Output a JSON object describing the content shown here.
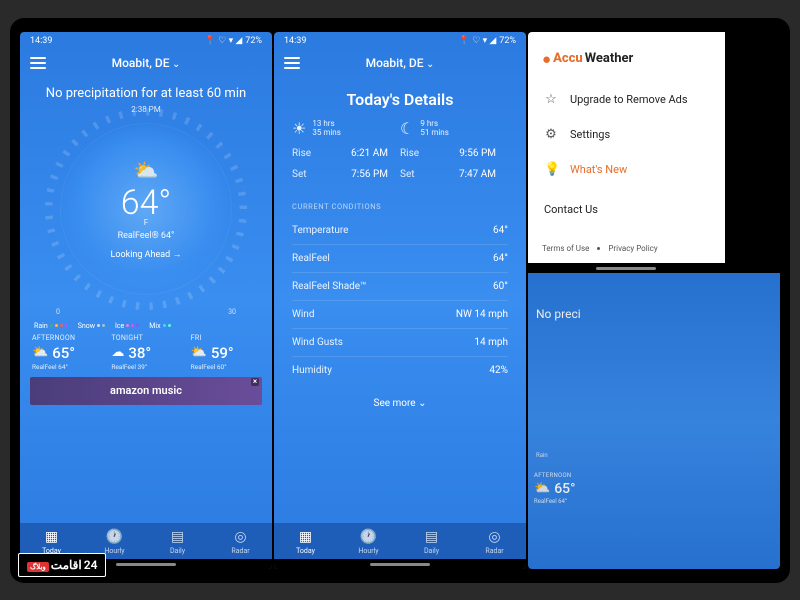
{
  "status": {
    "time": "14:39",
    "battery": "72%"
  },
  "location": "Moabit, DE",
  "screen1": {
    "headline": "No precipitation for at least 60 min",
    "time_marker": "2:38 PM",
    "temp": "64°",
    "unit": "F",
    "realfeel": "RealFeel® 64°",
    "looking": "Looking Ahead",
    "axis": {
      "start": "0",
      "end": "30"
    },
    "legend": {
      "rain": "Rain",
      "snow": "Snow",
      "ice": "Ice",
      "mix": "Mix"
    },
    "forecast": [
      {
        "label": "AFTERNOON",
        "temp": "65°",
        "rf": "RealFeel 64°",
        "icon": "⛅"
      },
      {
        "label": "TONIGHT",
        "temp": "38°",
        "rf": "RealFeel 39°",
        "icon": "☁"
      },
      {
        "label": "FRI",
        "temp": "59°",
        "rf": "RealFeel 60°",
        "icon": "⛅"
      }
    ],
    "ad": "amazon music"
  },
  "screen2": {
    "title": "Today's Details",
    "sun": {
      "dur1": "13 hrs",
      "dur2": "35 mins",
      "rise_lbl": "Rise",
      "rise": "6:21 AM",
      "set_lbl": "Set",
      "set": "7:56 PM"
    },
    "moon": {
      "dur1": "9 hrs",
      "dur2": "51 mins",
      "rise_lbl": "Rise",
      "rise": "9:56 PM",
      "set_lbl": "Set",
      "set": "7:47 AM"
    },
    "section": "CURRENT CONDITIONS",
    "conditions": [
      {
        "k": "Temperature",
        "v": "64°"
      },
      {
        "k": "RealFeel",
        "v": "64°"
      },
      {
        "k": "RealFeel Shade™",
        "v": "60°"
      },
      {
        "k": "Wind",
        "v": "NW 14 mph"
      },
      {
        "k": "Wind Gusts",
        "v": "14 mph"
      },
      {
        "k": "Humidity",
        "v": "42%"
      }
    ],
    "seemore": "See more"
  },
  "tabs": [
    {
      "label": "Today",
      "icon": "▦"
    },
    {
      "label": "Hourly",
      "icon": "🕐"
    },
    {
      "label": "Daily",
      "icon": "▤"
    },
    {
      "label": "Radar",
      "icon": "◎"
    }
  ],
  "screen3": {
    "brand1": "Accu",
    "brand2": "Weather",
    "menu": [
      {
        "icon": "☆",
        "label": "Upgrade to Remove Ads",
        "cls": ""
      },
      {
        "icon": "⚙",
        "label": "Settings",
        "cls": ""
      },
      {
        "icon": "💡",
        "label": "What's New",
        "cls": "orange"
      }
    ],
    "contact": "Contact Us",
    "terms": "Terms of Use",
    "privacy": "Privacy Policy",
    "bd_headline": "No preci",
    "bd_legend": "Rain",
    "bd_fc": {
      "label": "AFTERNOON",
      "temp": "65°",
      "rf": "RealFeel 64°"
    }
  },
  "watermark": {
    "txt": "اقامت",
    "num": "24",
    "tag": "وبلاگ"
  }
}
